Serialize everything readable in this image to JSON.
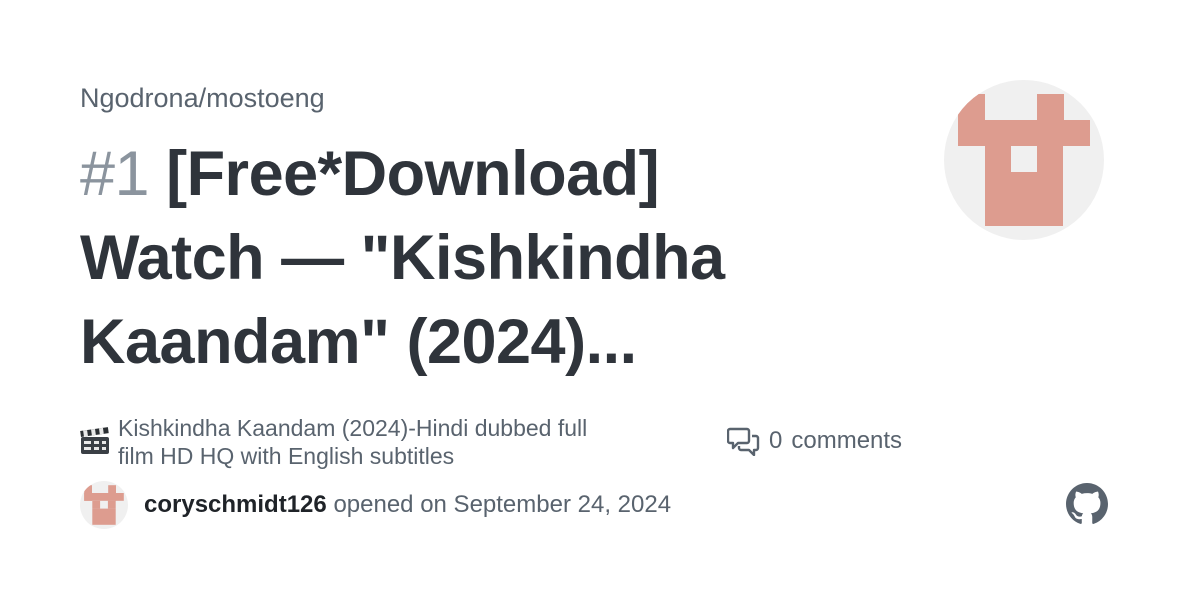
{
  "repo": {
    "path": "Ngodrona/mostoeng"
  },
  "issue": {
    "number": "#1",
    "title_line1": "[Free*Downlοad]",
    "title_line2": "Watch — \"Kishkindha",
    "title_line3": "Kaandam\" (2024)...",
    "description_line1": "Kishkindha Kaandam (2024)-Hindi dubbed full",
    "description_line2": "film HD HQ with English subtitles",
    "comments_count": "0",
    "comments_label": "comments",
    "author": "coryschmidt126",
    "opened_text": "opened on September 24, 2024"
  },
  "icons": {
    "description": "clapper-board-icon",
    "comments": "comment-discussion-icon",
    "brand": "github-mark-icon",
    "avatar": "identicon-avatar"
  },
  "colors": {
    "identicon": "#dd9c8f",
    "avatar_bg": "#f0f0f0",
    "text_primary": "#2f343b",
    "text_muted": "#59636e"
  }
}
